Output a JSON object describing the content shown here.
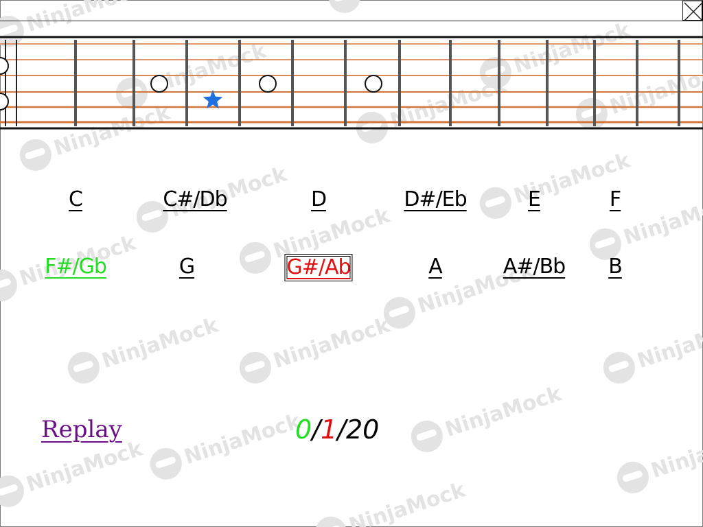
{
  "window": {
    "close_icon": "close-icon"
  },
  "watermark": {
    "text": "NinjaMock",
    "color": "#e3e3e3"
  },
  "fretboard": {
    "string_color": "#d4763a",
    "fret_color": "#555555",
    "markers": [
      {
        "type": "circle",
        "fret": 2,
        "string": 3
      },
      {
        "type": "star",
        "fret": 3,
        "string": 4,
        "color": "#1e6fe0",
        "icon": "star-icon"
      },
      {
        "type": "circle",
        "fret": 4,
        "string": 3
      },
      {
        "type": "circle",
        "fret": 6,
        "string": 3
      },
      {
        "type": "circle",
        "fret": 12,
        "string": 2
      },
      {
        "type": "circle",
        "fret": 12,
        "string": 5
      }
    ]
  },
  "notes": {
    "row1": [
      "C",
      "C#/Db",
      "D",
      "D#/Eb",
      "E",
      "F"
    ],
    "row2": [
      "F#/Gb",
      "G",
      "G#/Ab",
      "A",
      "A#/Bb",
      "B"
    ],
    "selected": "G#/Ab",
    "correct": "F#/Gb",
    "correct_color": "#22dd22",
    "selected_color": "#e01010"
  },
  "replay": {
    "label": "Replay",
    "color": "#6a0f85"
  },
  "score": {
    "correct": "0",
    "sep1": "/",
    "wrong": "1",
    "sep2": "/",
    "total": "20"
  }
}
